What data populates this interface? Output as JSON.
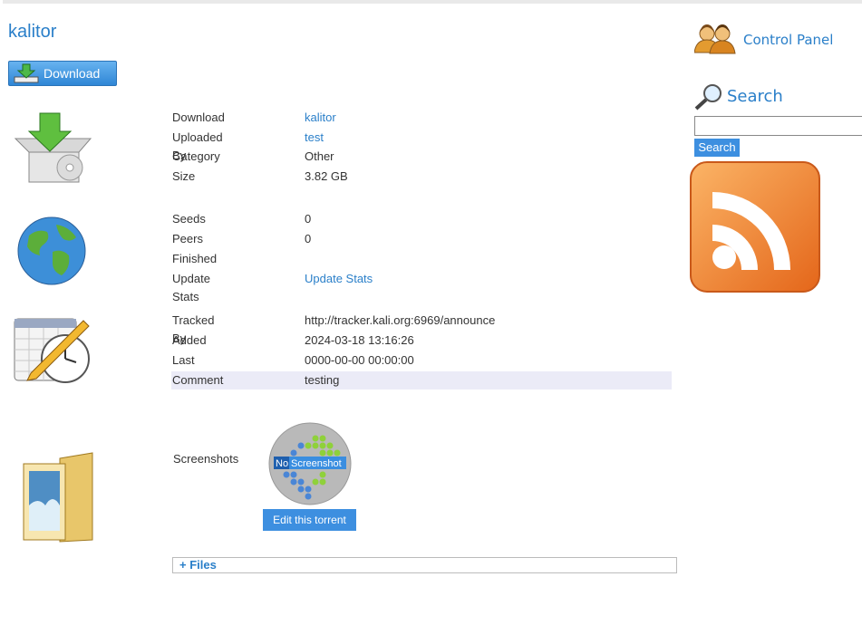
{
  "torrent": {
    "name": "kalitor"
  },
  "download_button": {
    "label": "Download",
    "icon": "download-arrow-icon"
  },
  "details": {
    "download_key": "Download",
    "download_val": "kalitor",
    "uploader_key": "Uploaded By",
    "uploader_val": "test",
    "category_key": "Category",
    "category_val": "Other",
    "size_key": "Size",
    "size_val": "3.82 GB"
  },
  "stats": {
    "seeds_key": "Seeds",
    "seeds_val": "0",
    "peers_key": "Peers",
    "peers_val": "0",
    "finished_key": "Finished",
    "finished_val": "",
    "update_key": "Update Stats",
    "update_val": "Update Stats"
  },
  "tracking": {
    "tracked_key": "Tracked By",
    "tracked_val": "http://tracker.kali.org:6969/announce",
    "added_key": "Added",
    "added_val": "2024-03-18 13:16:26",
    "last_key": "Last Update",
    "last_val": "0000-00-00 00:00:00",
    "comment_key": "Comment",
    "comment_val": "testing"
  },
  "screenshots": {
    "label": "Screenshots",
    "no_prefix": "No",
    "no_text": "Screenshot",
    "edit_label": "Edit this torrent"
  },
  "files": {
    "label": "+ Files"
  },
  "sidebar": {
    "control_panel": "Control Panel",
    "search_title": "Search",
    "search_value": "",
    "search_button": "Search"
  },
  "colors": {
    "accent": "#2a7fc9",
    "button": "#3d8fe0",
    "rss": "#f58220"
  }
}
